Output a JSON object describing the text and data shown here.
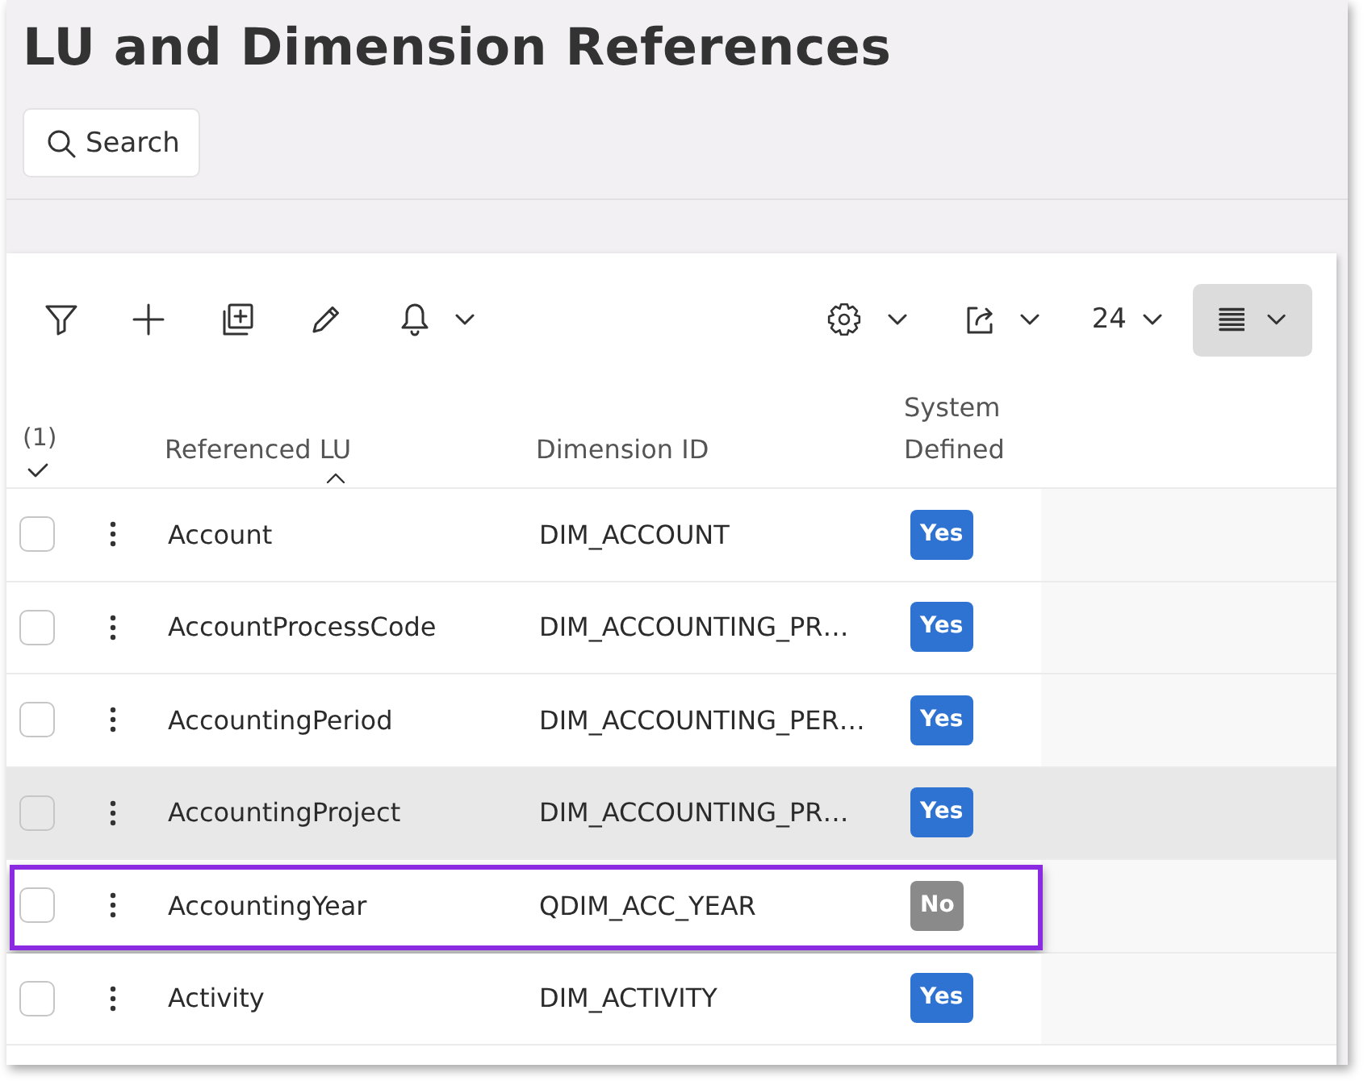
{
  "page": {
    "title": "LU and Dimension References"
  },
  "search_button": {
    "label": "Search"
  },
  "toolbar": {
    "page_size": "24"
  },
  "table": {
    "selection_count": "(1)",
    "columns": [
      {
        "label": "Referenced LU",
        "sorted": true
      },
      {
        "label": "Dimension ID",
        "sorted": false
      },
      {
        "label": "System Defined",
        "sorted": false
      }
    ],
    "rows": [
      {
        "referenced_lu": "Account",
        "dimension_id": "DIM_ACCOUNT",
        "system_defined": {
          "label": "Yes",
          "on": true
        },
        "checked": false,
        "hovered": false,
        "highlighted": false
      },
      {
        "referenced_lu": "AccountProcessCode",
        "dimension_id": "DIM_ACCOUNTING_PR…",
        "system_defined": {
          "label": "Yes",
          "on": true
        },
        "checked": false,
        "hovered": false,
        "highlighted": false
      },
      {
        "referenced_lu": "AccountingPeriod",
        "dimension_id": "DIM_ACCOUNTING_PER…",
        "system_defined": {
          "label": "Yes",
          "on": true
        },
        "checked": false,
        "hovered": false,
        "highlighted": false
      },
      {
        "referenced_lu": "AccountingProject",
        "dimension_id": "DIM_ACCOUNTING_PR…",
        "system_defined": {
          "label": "Yes",
          "on": true
        },
        "checked": false,
        "hovered": true,
        "highlighted": false
      },
      {
        "referenced_lu": "AccountingYear",
        "dimension_id": "QDIM_ACC_YEAR",
        "system_defined": {
          "label": "No",
          "on": false
        },
        "checked": false,
        "hovered": false,
        "highlighted": true
      },
      {
        "referenced_lu": "Activity",
        "dimension_id": "DIM_ACTIVITY",
        "system_defined": {
          "label": "Yes",
          "on": true
        },
        "checked": false,
        "hovered": false,
        "highlighted": false
      }
    ]
  }
}
